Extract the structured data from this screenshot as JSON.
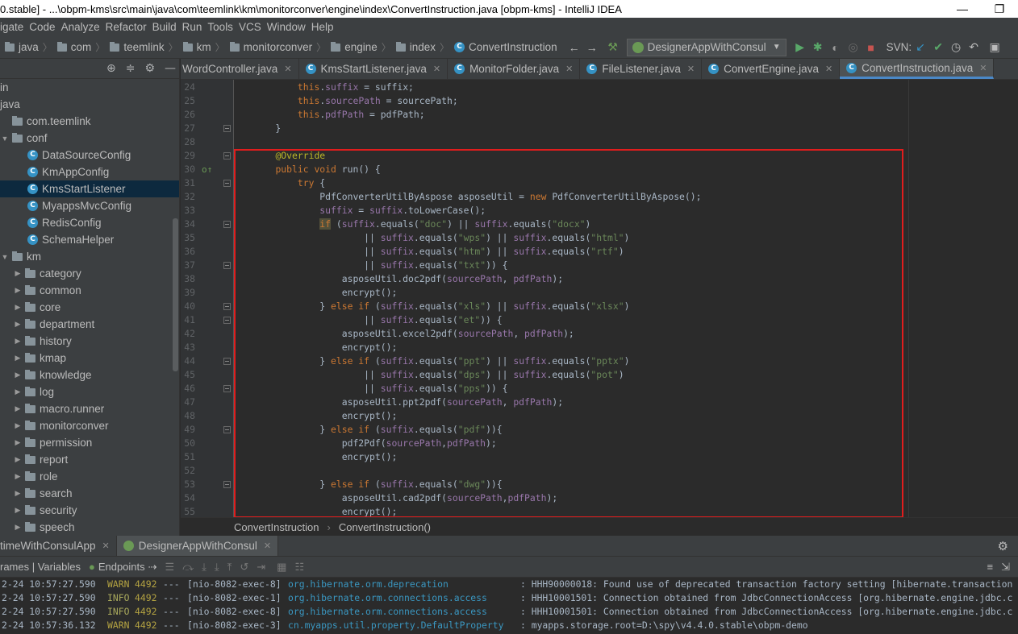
{
  "window": {
    "title": "0.stable] - ...\\obpm-kms\\src\\main\\java\\com\\teemlink\\km\\monitorconver\\engine\\index\\ConvertInstruction.java [obpm-kms] - IntelliJ IDEA",
    "minimize": "—",
    "restore": "❐"
  },
  "menu": [
    "igate",
    "Code",
    "Analyze",
    "Refactor",
    "Build",
    "Run",
    "Tools",
    "VCS",
    "Window",
    "Help"
  ],
  "nav": {
    "crumbs": [
      "java",
      "com",
      "teemlink",
      "km",
      "monitorconver",
      "engine",
      "index"
    ],
    "current_file": "ConvertInstruction",
    "run_config": "DesignerAppWithConsul",
    "svn_label": "SVN:"
  },
  "project": {
    "tree": [
      {
        "label": "in",
        "type": "text",
        "indent": 0
      },
      {
        "label": "java",
        "type": "text",
        "indent": 0
      },
      {
        "label": "com.teemlink",
        "type": "folder",
        "indent": 0,
        "arrow": ""
      },
      {
        "label": "conf",
        "type": "folder",
        "indent": 1,
        "arrow": "▼"
      },
      {
        "label": "DataSourceConfig",
        "type": "class",
        "indent": 2
      },
      {
        "label": "KmAppConfig",
        "type": "class",
        "indent": 2
      },
      {
        "label": "KmsStartListener",
        "type": "class",
        "indent": 2,
        "selected": true
      },
      {
        "label": "MyappsMvcConfig",
        "type": "class",
        "indent": 2
      },
      {
        "label": "RedisConfig",
        "type": "class",
        "indent": 2
      },
      {
        "label": "SchemaHelper",
        "type": "class",
        "indent": 2
      },
      {
        "label": "km",
        "type": "folder",
        "indent": 1,
        "arrow": "▼"
      },
      {
        "label": "category",
        "type": "folder",
        "indent": 2,
        "arrow": "▶"
      },
      {
        "label": "common",
        "type": "folder",
        "indent": 2,
        "arrow": "▶"
      },
      {
        "label": "core",
        "type": "folder",
        "indent": 2,
        "arrow": "▶"
      },
      {
        "label": "department",
        "type": "folder",
        "indent": 2,
        "arrow": "▶"
      },
      {
        "label": "history",
        "type": "folder",
        "indent": 2,
        "arrow": "▶"
      },
      {
        "label": "kmap",
        "type": "folder",
        "indent": 2,
        "arrow": "▶"
      },
      {
        "label": "knowledge",
        "type": "folder",
        "indent": 2,
        "arrow": "▶"
      },
      {
        "label": "log",
        "type": "folder",
        "indent": 2,
        "arrow": "▶"
      },
      {
        "label": "macro.runner",
        "type": "folder",
        "indent": 2,
        "arrow": "▶"
      },
      {
        "label": "monitorconver",
        "type": "folder",
        "indent": 2,
        "arrow": "▶"
      },
      {
        "label": "permission",
        "type": "folder",
        "indent": 2,
        "arrow": "▶"
      },
      {
        "label": "report",
        "type": "folder",
        "indent": 2,
        "arrow": "▶"
      },
      {
        "label": "role",
        "type": "folder",
        "indent": 2,
        "arrow": "▶"
      },
      {
        "label": "search",
        "type": "folder",
        "indent": 2,
        "arrow": "▶"
      },
      {
        "label": "security",
        "type": "folder",
        "indent": 2,
        "arrow": "▶"
      },
      {
        "label": "speech",
        "type": "folder",
        "indent": 2,
        "arrow": "▶"
      }
    ]
  },
  "tabs": [
    {
      "label": "WordController.java",
      "active": false
    },
    {
      "label": "KmsStartListener.java",
      "active": false
    },
    {
      "label": "MonitorFolder.java",
      "active": false
    },
    {
      "label": "FileListener.java",
      "active": false
    },
    {
      "label": "ConvertEngine.java",
      "active": false
    },
    {
      "label": "ConvertInstruction.java",
      "active": true
    }
  ],
  "code_lines": [
    {
      "n": "24",
      "tokens": [
        [
          "        ",
          ""
        ],
        [
          "this",
          "kw"
        ],
        [
          ".",
          ""
        ],
        [
          "suffix",
          "fld"
        ],
        [
          " = suffix;",
          ""
        ]
      ]
    },
    {
      "n": "25",
      "tokens": [
        [
          "        ",
          ""
        ],
        [
          "this",
          "kw"
        ],
        [
          ".",
          ""
        ],
        [
          "sourcePath",
          "fld"
        ],
        [
          " = sourcePath;",
          ""
        ]
      ]
    },
    {
      "n": "26",
      "tokens": [
        [
          "        ",
          ""
        ],
        [
          "this",
          "kw"
        ],
        [
          ".",
          ""
        ],
        [
          "pdfPath",
          "fld"
        ],
        [
          " = pdfPath;",
          ""
        ]
      ]
    },
    {
      "n": "27",
      "tokens": [
        [
          "    }",
          ""
        ]
      ],
      "fold": true
    },
    {
      "n": "28",
      "tokens": []
    },
    {
      "n": "29",
      "tokens": [
        [
          "    ",
          ""
        ],
        [
          "@Override",
          "ann"
        ]
      ],
      "fold": true
    },
    {
      "n": "30",
      "tokens": [
        [
          "    ",
          ""
        ],
        [
          "public void ",
          "kw"
        ],
        [
          "run",
          ""
        ],
        [
          "() {",
          ""
        ]
      ],
      "override": true
    },
    {
      "n": "31",
      "tokens": [
        [
          "        ",
          ""
        ],
        [
          "try",
          "kw"
        ],
        [
          " {",
          ""
        ]
      ],
      "fold": true
    },
    {
      "n": "32",
      "tokens": [
        [
          "            PdfConverterUtilByAspose asposeUtil = ",
          ""
        ],
        [
          "new ",
          "kw"
        ],
        [
          "PdfConverterUtilByAspose();",
          ""
        ]
      ]
    },
    {
      "n": "33",
      "tokens": [
        [
          "            ",
          ""
        ],
        [
          "suffix",
          "fld"
        ],
        [
          " = ",
          ""
        ],
        [
          "suffix",
          "fld"
        ],
        [
          ".toLowerCase();",
          ""
        ]
      ]
    },
    {
      "n": "34",
      "tokens": [
        [
          "            ",
          ""
        ],
        [
          "if",
          "kw hl"
        ],
        [
          " (",
          ""
        ],
        [
          "suffix",
          "fld"
        ],
        [
          ".equals(",
          ""
        ],
        [
          "\"doc\"",
          "str"
        ],
        [
          ") || ",
          ""
        ],
        [
          "suffix",
          "fld"
        ],
        [
          ".equals(",
          ""
        ],
        [
          "\"docx\"",
          "str"
        ],
        [
          ")",
          ""
        ]
      ],
      "fold": true
    },
    {
      "n": "35",
      "tokens": [
        [
          "                    || ",
          ""
        ],
        [
          "suffix",
          "fld"
        ],
        [
          ".equals(",
          ""
        ],
        [
          "\"wps\"",
          "str"
        ],
        [
          ") || ",
          ""
        ],
        [
          "suffix",
          "fld"
        ],
        [
          ".equals(",
          ""
        ],
        [
          "\"html\"",
          "str"
        ],
        [
          ")",
          ""
        ]
      ]
    },
    {
      "n": "36",
      "tokens": [
        [
          "                    || ",
          ""
        ],
        [
          "suffix",
          "fld"
        ],
        [
          ".equals(",
          ""
        ],
        [
          "\"htm\"",
          "str"
        ],
        [
          ") || ",
          ""
        ],
        [
          "suffix",
          "fld"
        ],
        [
          ".equals(",
          ""
        ],
        [
          "\"rtf\"",
          "str"
        ],
        [
          ")",
          ""
        ]
      ]
    },
    {
      "n": "37",
      "tokens": [
        [
          "                    || ",
          ""
        ],
        [
          "suffix",
          "fld"
        ],
        [
          ".equals(",
          ""
        ],
        [
          "\"txt\"",
          "str"
        ],
        [
          ")) {",
          ""
        ]
      ],
      "fold": true
    },
    {
      "n": "38",
      "tokens": [
        [
          "                asposeUtil.doc2pdf(",
          ""
        ],
        [
          "sourcePath",
          "fld"
        ],
        [
          ", ",
          ""
        ],
        [
          "pdfPath",
          "fld"
        ],
        [
          ");",
          ""
        ]
      ]
    },
    {
      "n": "39",
      "tokens": [
        [
          "                encrypt();",
          ""
        ]
      ]
    },
    {
      "n": "40",
      "tokens": [
        [
          "            } ",
          ""
        ],
        [
          "else if",
          "kw"
        ],
        [
          " (",
          ""
        ],
        [
          "suffix",
          "fld"
        ],
        [
          ".equals(",
          ""
        ],
        [
          "\"xls\"",
          "str"
        ],
        [
          ") || ",
          ""
        ],
        [
          "suffix",
          "fld"
        ],
        [
          ".equals(",
          ""
        ],
        [
          "\"xlsx\"",
          "str"
        ],
        [
          ")",
          ""
        ]
      ],
      "fold": true
    },
    {
      "n": "41",
      "tokens": [
        [
          "                    || ",
          ""
        ],
        [
          "suffix",
          "fld"
        ],
        [
          ".equals(",
          ""
        ],
        [
          "\"et\"",
          "str"
        ],
        [
          ")) {",
          ""
        ]
      ],
      "fold": true
    },
    {
      "n": "42",
      "tokens": [
        [
          "                asposeUtil.excel2pdf(",
          ""
        ],
        [
          "sourcePath",
          "fld"
        ],
        [
          ", ",
          ""
        ],
        [
          "pdfPath",
          "fld"
        ],
        [
          ");",
          ""
        ]
      ]
    },
    {
      "n": "43",
      "tokens": [
        [
          "                encrypt();",
          ""
        ]
      ]
    },
    {
      "n": "44",
      "tokens": [
        [
          "            } ",
          ""
        ],
        [
          "else if",
          "kw"
        ],
        [
          " (",
          ""
        ],
        [
          "suffix",
          "fld"
        ],
        [
          ".equals(",
          ""
        ],
        [
          "\"ppt\"",
          "str"
        ],
        [
          ") || ",
          ""
        ],
        [
          "suffix",
          "fld"
        ],
        [
          ".equals(",
          ""
        ],
        [
          "\"pptx\"",
          "str"
        ],
        [
          ")",
          ""
        ]
      ],
      "fold": true
    },
    {
      "n": "45",
      "tokens": [
        [
          "                    || ",
          ""
        ],
        [
          "suffix",
          "fld"
        ],
        [
          ".equals(",
          ""
        ],
        [
          "\"dps\"",
          "str"
        ],
        [
          ") || ",
          ""
        ],
        [
          "suffix",
          "fld"
        ],
        [
          ".equals(",
          ""
        ],
        [
          "\"pot\"",
          "str"
        ],
        [
          ")",
          ""
        ]
      ]
    },
    {
      "n": "46",
      "tokens": [
        [
          "                    || ",
          ""
        ],
        [
          "suffix",
          "fld"
        ],
        [
          ".equals(",
          ""
        ],
        [
          "\"pps\"",
          "str"
        ],
        [
          ")) {",
          ""
        ]
      ],
      "fold": true
    },
    {
      "n": "47",
      "tokens": [
        [
          "                asposeUtil.ppt2pdf(",
          ""
        ],
        [
          "sourcePath",
          "fld"
        ],
        [
          ", ",
          ""
        ],
        [
          "pdfPath",
          "fld"
        ],
        [
          ");",
          ""
        ]
      ]
    },
    {
      "n": "48",
      "tokens": [
        [
          "                encrypt();",
          ""
        ]
      ]
    },
    {
      "n": "49",
      "tokens": [
        [
          "            } ",
          ""
        ],
        [
          "else if",
          "kw"
        ],
        [
          " (",
          ""
        ],
        [
          "suffix",
          "fld"
        ],
        [
          ".equals(",
          ""
        ],
        [
          "\"pdf\"",
          "str"
        ],
        [
          ")){",
          ""
        ]
      ],
      "fold": true
    },
    {
      "n": "50",
      "tokens": [
        [
          "                pdf2Pdf(",
          ""
        ],
        [
          "sourcePath",
          "fld"
        ],
        [
          ",",
          ""
        ],
        [
          "pdfPath",
          "fld"
        ],
        [
          ");",
          ""
        ]
      ]
    },
    {
      "n": "51",
      "tokens": [
        [
          "                encrypt();",
          ""
        ]
      ]
    },
    {
      "n": "52",
      "tokens": []
    },
    {
      "n": "53",
      "tokens": [
        [
          "            } ",
          ""
        ],
        [
          "else if",
          "kw"
        ],
        [
          " (",
          ""
        ],
        [
          "suffix",
          "fld"
        ],
        [
          ".equals(",
          ""
        ],
        [
          "\"dwg\"",
          "str"
        ],
        [
          ")){",
          ""
        ]
      ],
      "fold": true
    },
    {
      "n": "54",
      "tokens": [
        [
          "                asposeUtil.cad2pdf(",
          ""
        ],
        [
          "sourcePath",
          "fld"
        ],
        [
          ",",
          ""
        ],
        [
          "pdfPath",
          "fld"
        ],
        [
          ");",
          ""
        ]
      ]
    },
    {
      "n": "55",
      "tokens": [
        [
          "                encrypt();",
          ""
        ]
      ]
    }
  ],
  "breadcrumb": [
    "ConvertInstruction",
    "ConvertInstruction()"
  ],
  "run_panel": {
    "tabs": [
      {
        "label": "timeWithConsulApp",
        "active": false
      },
      {
        "label": "DesignerAppWithConsul",
        "active": true
      }
    ],
    "subtabs": [
      "rames | Variables",
      "Endpoints"
    ],
    "logs": [
      {
        "time": "2-24 10:57:27.590",
        "level": "WARN",
        "pid": "4492",
        "sep": "---",
        "thread": "[nio-8082-exec-8]",
        "logger": "org.hibernate.orm.deprecation",
        "msg": ": HHH90000018: Found use of deprecated transaction factory setting [hibernate.transaction"
      },
      {
        "time": "2-24 10:57:27.590",
        "level": "INFO",
        "pid": "4492",
        "sep": "---",
        "thread": "[nio-8082-exec-1]",
        "logger": "org.hibernate.orm.connections.access",
        "msg": ": HHH10001501: Connection obtained from JdbcConnectionAccess [org.hibernate.engine.jdbc.c"
      },
      {
        "time": "2-24 10:57:27.590",
        "level": "INFO",
        "pid": "4492",
        "sep": "---",
        "thread": "[nio-8082-exec-8]",
        "logger": "org.hibernate.orm.connections.access",
        "msg": ": HHH10001501: Connection obtained from JdbcConnectionAccess [org.hibernate.engine.jdbc.c"
      },
      {
        "time": "2-24 10:57:36.132",
        "level": "WARN",
        "pid": "4492",
        "sep": "---",
        "thread": "[nio-8082-exec-3]",
        "logger": "cn.myapps.util.property.DefaultProperty",
        "msg": ": myapps.storage.root=D:\\spy\\v4.4.0.stable\\obpm-demo"
      }
    ]
  }
}
